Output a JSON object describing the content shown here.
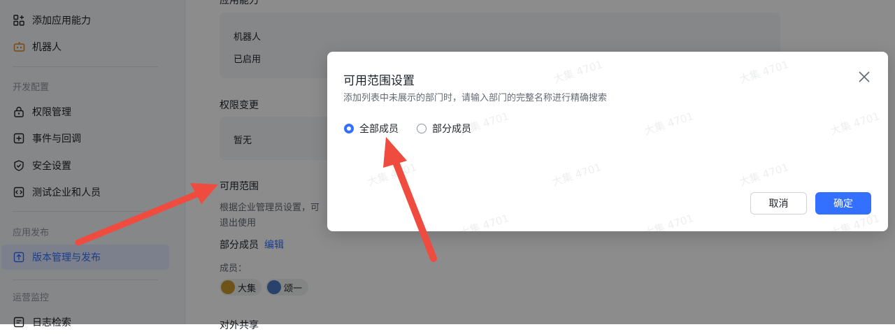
{
  "sidebar": {
    "items_top": [
      {
        "label": "添加应用能力",
        "icon": "grid-plus-icon"
      },
      {
        "label": "机器人",
        "icon": "robot-icon"
      }
    ],
    "section_dev": "开发配置",
    "items_dev": [
      {
        "label": "权限管理",
        "icon": "lock-icon"
      },
      {
        "label": "事件与回调",
        "icon": "plus-square-icon"
      },
      {
        "label": "安全设置",
        "icon": "shield-icon"
      },
      {
        "label": "测试企业和人员",
        "icon": "code-icon"
      }
    ],
    "section_publish": "应用发布",
    "item_publish": {
      "label": "版本管理与发布",
      "icon": "upload-icon"
    },
    "section_monitor": "运营监控",
    "item_monitor": {
      "label": "日志检索",
      "icon": "log-icon"
    }
  },
  "main": {
    "capability_heading": "应用能力",
    "capability_name": "机器人",
    "capability_status": "已启用",
    "permission_heading": "权限变更",
    "permission_value": "暂无",
    "scope_heading": "可用范围",
    "scope_desc_line1": "根据企业管理员设置，可",
    "scope_desc_line2": "退出使用",
    "scope_mode": "部分成员",
    "edit_link": "编辑",
    "members_label": "成员：",
    "members": [
      {
        "name": "大集",
        "avatar_color": "#c99a2e"
      },
      {
        "name": "颂一",
        "avatar_color": "#4a78c4"
      }
    ],
    "share_heading": "对外共享"
  },
  "modal": {
    "title": "可用范围设置",
    "subtitle": "添加列表中未展示的部门时，请输入部门的完整名称进行精确搜索",
    "options": [
      {
        "label": "全部成员",
        "checked": true
      },
      {
        "label": "部分成员",
        "checked": false
      }
    ],
    "cancel_label": "取消",
    "confirm_label": "确定",
    "watermark": "大集 4701",
    "accent_color": "#3370ff",
    "arrow_color": "#f04b3f"
  }
}
